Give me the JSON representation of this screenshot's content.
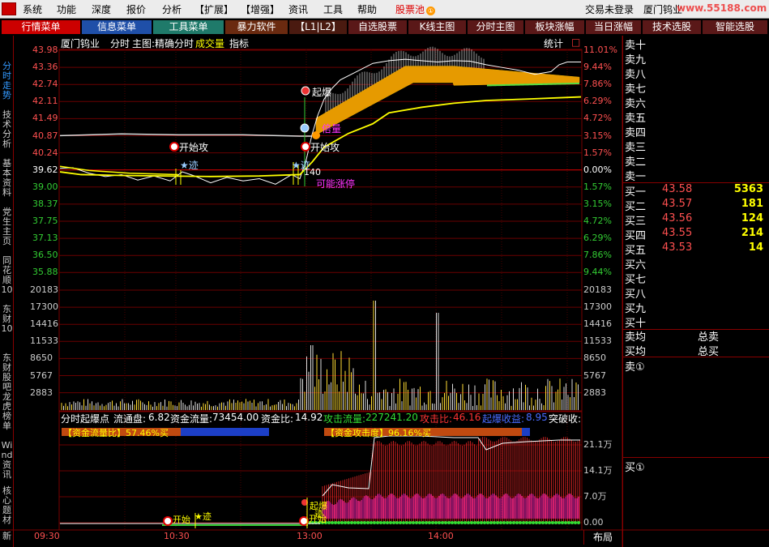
{
  "menubar": {
    "items": [
      "系统",
      "功能",
      "深度",
      "报价",
      "分析",
      "【扩展】",
      "【增强】",
      "资讯",
      "工具",
      "帮助"
    ],
    "stock_pool": "股票池",
    "login_status": "交易未登录",
    "window_title": "厦门钨业",
    "watermark": "www.55188.com"
  },
  "tabs": [
    {
      "label": "行情菜单",
      "bg": "#cc0000"
    },
    {
      "label": "信息菜单",
      "bg": "#1f4fa8"
    },
    {
      "label": "工具菜单",
      "bg": "#1f7a6a"
    },
    {
      "label": "暴力软件",
      "bg": "#6a2a10"
    },
    {
      "label": "【L1|L2】",
      "bg": "#4a1a10"
    },
    {
      "label": "自选股票",
      "bg": "#5a1818"
    },
    {
      "label": "K线主图",
      "bg": "#5a1818"
    },
    {
      "label": "分时主图",
      "bg": "#5a1818"
    },
    {
      "label": "板块涨幅",
      "bg": "#5a1818"
    },
    {
      "label": "当日涨幅",
      "bg": "#5a1818"
    },
    {
      "label": "技术选股",
      "bg": "#5a1818"
    },
    {
      "label": "智能选股",
      "bg": "#5a1818"
    }
  ],
  "sidebar": [
    "分时走势",
    "技术分析",
    "基本资料",
    "党生主页",
    "同花顺10",
    "东财10",
    "东财股吧",
    "龙虎榜单",
    "Wind资讯",
    "核心题材",
    "新"
  ],
  "chart_header": {
    "name": "厦门钨业",
    "mode": "分时",
    "main": "主图:精确分时",
    "volume": "成交量",
    "indicator": "指标",
    "stats": "统计",
    "close_box": "□"
  },
  "price_axis": {
    "left": [
      "43.98",
      "43.36",
      "42.74",
      "42.11",
      "41.49",
      "40.87",
      "40.24",
      "39.62",
      "39.00",
      "38.37",
      "37.75",
      "37.13",
      "36.50",
      "35.88"
    ],
    "right": [
      "11.01%",
      "9.44%",
      "7.86%",
      "6.29%",
      "4.72%",
      "3.15%",
      "1.57%",
      "0.00%",
      "1.57%",
      "3.15%",
      "4.72%",
      "6.29%",
      "7.86%",
      "9.44%"
    ]
  },
  "volume_axis": [
    "20183",
    "17300",
    "14416",
    "11533",
    "8650",
    "5767",
    "2883"
  ],
  "annotations": {
    "start_attack_1": "开始攻",
    "trace_1": "★迹",
    "qi_bao": "起爆",
    "big_volume": "倍量",
    "start_attack_2": "开始攻",
    "trace_2": "★迹",
    "num_140": "140",
    "limit_up": "可能涨停",
    "lower_start": "开始",
    "lower_trace": "★迹",
    "lower_qibao": "起爆",
    "lower_start2": "开始",
    "lower_trace2": "迹"
  },
  "indicator_info": {
    "name": "分时起爆点",
    "float_label": "流通盘:",
    "float_val": "6.82",
    "fund_flow_label": "资金流量:",
    "fund_flow_val": "73454.00",
    "fund_ratio_label": "资金比:",
    "fund_ratio_val": "14.92",
    "attack_flow_label": "攻击流量:",
    "attack_flow_val": "227241.20",
    "attack_ratio_label": "攻击比:",
    "attack_ratio_val": "46.16",
    "qibao_label": "起爆收益:",
    "qibao_val": "8.95",
    "break_label": "突破收:"
  },
  "bars": {
    "fund_flow_bar": "【资金流量比】57.46%买",
    "attack_bar": "【资金攻击度】96.16%买",
    "fund_flow_pct": 0.5746,
    "attack_pct": 0.9616
  },
  "lower_axis": [
    "21.1万",
    "14.1万",
    "7.0万",
    "0.00"
  ],
  "time_axis": [
    "09:30",
    "10:30",
    "13:00",
    "14:00"
  ],
  "layout_btn": "布局",
  "order_book": {
    "asks": [
      "卖十",
      "卖九",
      "卖八",
      "卖七",
      "卖六",
      "卖五",
      "卖四",
      "卖三",
      "卖二",
      "卖一"
    ],
    "bids": [
      {
        "label": "买一",
        "price": "43.58",
        "vol": "5363"
      },
      {
        "label": "买二",
        "price": "43.57",
        "vol": "181"
      },
      {
        "label": "买三",
        "price": "43.56",
        "vol": "124"
      },
      {
        "label": "买四",
        "price": "43.55",
        "vol": "214"
      },
      {
        "label": "买五",
        "price": "43.53",
        "vol": "14"
      },
      {
        "label": "买六",
        "price": "",
        "vol": ""
      },
      {
        "label": "买七",
        "price": "",
        "vol": ""
      },
      {
        "label": "买八",
        "price": "",
        "vol": ""
      },
      {
        "label": "买九",
        "price": "",
        "vol": ""
      },
      {
        "label": "买十",
        "price": "",
        "vol": ""
      }
    ],
    "avg_sell": "卖均",
    "total_sell": "总卖",
    "avg_buy": "买均",
    "total_buy": "总买",
    "sell_queue": "卖①",
    "buy_queue": "买①"
  },
  "colors": {
    "up": "#ff4040",
    "down": "#33cc33",
    "price_line": "#ffffff",
    "avg_line": "#ffff00",
    "band": "#e69a00",
    "grid": "#7a0000"
  }
}
